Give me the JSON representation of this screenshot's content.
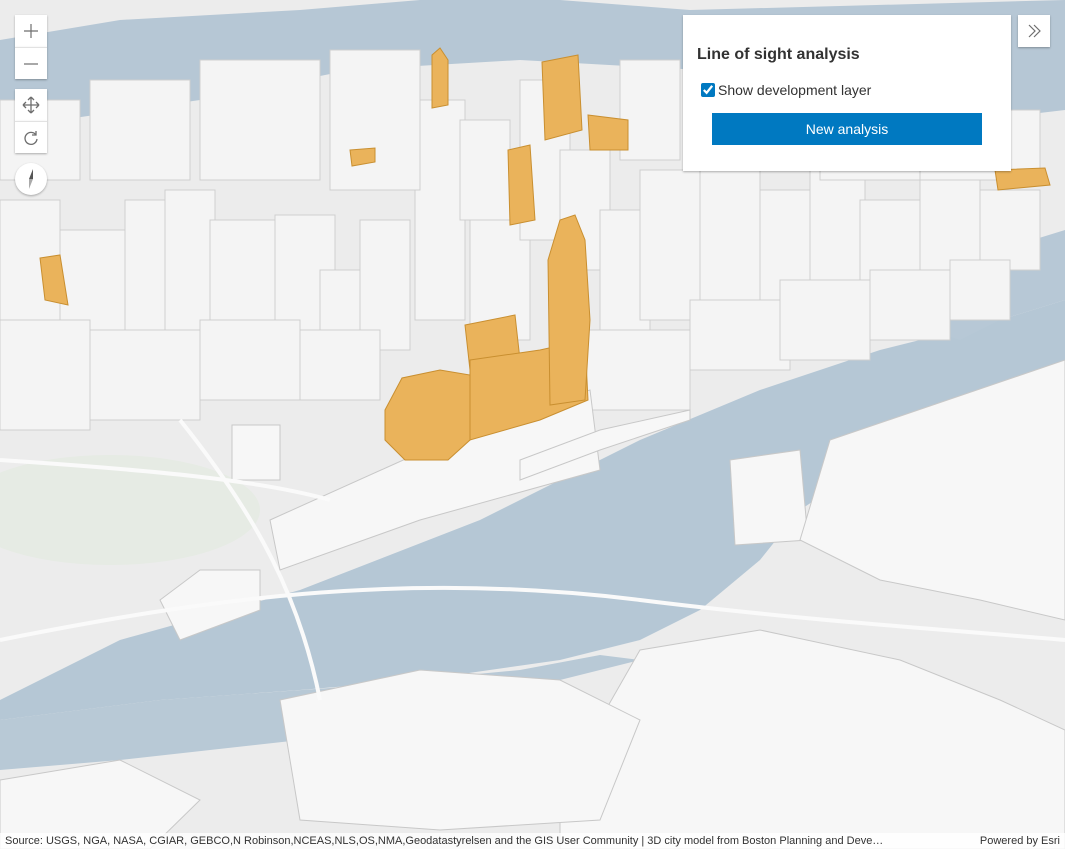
{
  "map": {
    "colors": {
      "water": "#b4c6d4",
      "land": "#ededed",
      "building": "#f7f7f7",
      "building_edge": "#c9c9c9",
      "development": "#eab35b"
    },
    "zoom_in_icon": "plus-icon",
    "zoom_out_icon": "minus-icon",
    "pan_icon": "pan-arrows-icon",
    "rotate_icon": "rotate-icon",
    "compass_icon": "compass-icon",
    "expand_icon": "double-chevron-right-icon"
  },
  "panel": {
    "title": "Line of sight analysis",
    "checkbox_label": "Show development layer",
    "checkbox_checked": true,
    "button_label": "New analysis",
    "accent_color": "#0079c1"
  },
  "attribution": {
    "text": "Source: USGS, NGA, NASA, CGIAR, GEBCO,N Robinson,NCEAS,NLS,OS,NMA,Geodatastyrelsen and the GIS User Community | 3D city model from Boston Planning and Deve…",
    "powered_by": "Powered by Esri"
  }
}
